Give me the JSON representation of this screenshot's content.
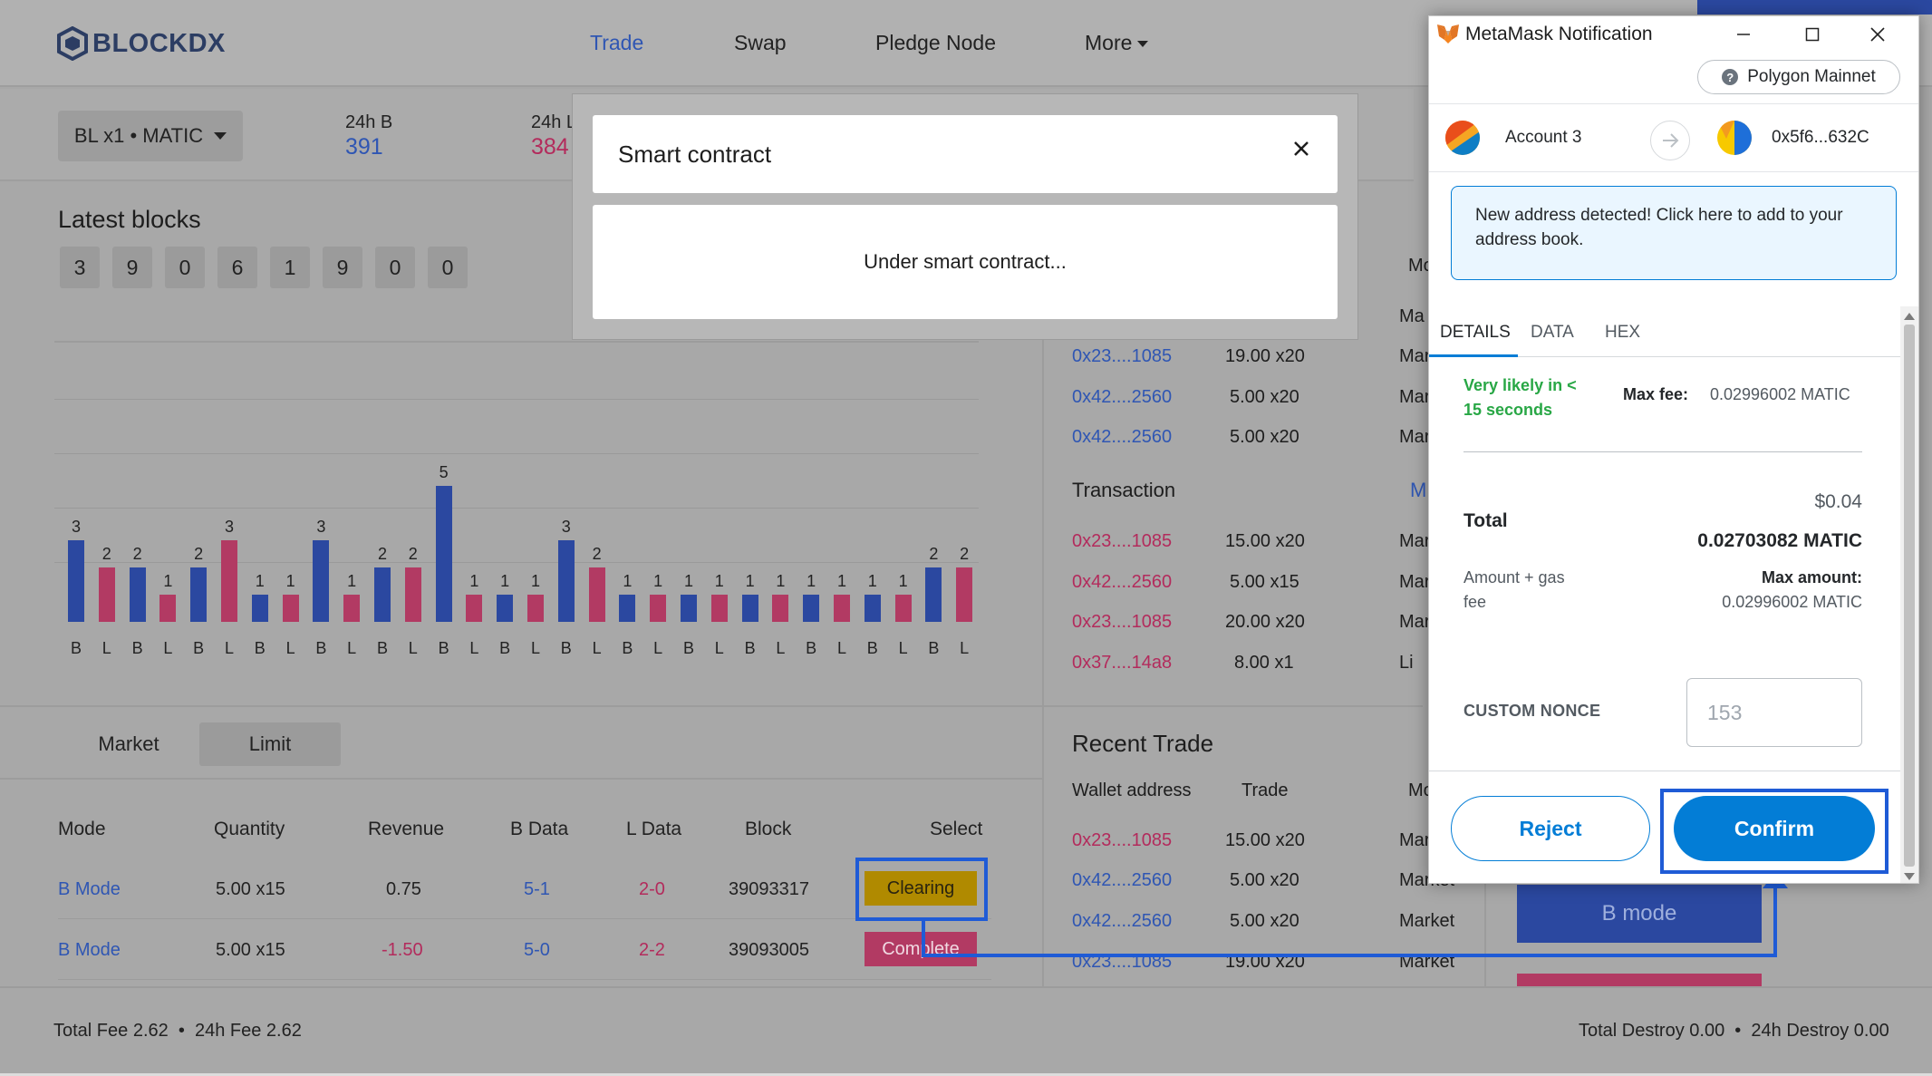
{
  "app": {
    "brand": "BLOCKDX",
    "nav": [
      "Trade",
      "Swap",
      "Pledge Node",
      "More"
    ],
    "active_nav": "Trade"
  },
  "market": {
    "pair": "BL x1 • MATIC",
    "stat1_label": "24h B",
    "stat1_value": "391",
    "stat2_label": "24h L",
    "stat2_value": "384"
  },
  "latest_blocks": {
    "title": "Latest blocks",
    "digits": [
      "3",
      "9",
      "0",
      "6",
      "1",
      "9",
      "0",
      "0"
    ]
  },
  "chart_data": {
    "type": "bar",
    "categories": [
      "B",
      "L",
      "B",
      "L",
      "B",
      "L",
      "B",
      "L",
      "B",
      "L",
      "B",
      "L",
      "B",
      "L",
      "B",
      "L",
      "B",
      "L",
      "B",
      "L",
      "B",
      "L",
      "B",
      "L",
      "B",
      "L",
      "B",
      "L",
      "B",
      "L"
    ],
    "values": [
      3,
      2,
      2,
      1,
      2,
      3,
      1,
      1,
      3,
      1,
      2,
      2,
      5,
      1,
      1,
      1,
      3,
      2,
      1,
      1,
      1,
      1,
      1,
      1,
      1,
      1,
      1,
      1,
      2,
      2
    ],
    "colors": {
      "B": "#2b48a0",
      "L": "#b23a63"
    },
    "ylim": [
      0,
      6
    ]
  },
  "order_tabs": [
    "Market",
    "Limit"
  ],
  "orders": {
    "headers": [
      "Mode",
      "Quantity",
      "Revenue",
      "B Data",
      "L Data",
      "Block",
      "Select"
    ],
    "rows": [
      {
        "mode": "B Mode",
        "qty": "5.00 x15",
        "revenue": "0.75",
        "bdata": "5-1",
        "ldata": "2-0",
        "block": "39093317",
        "status": "Clearing"
      },
      {
        "mode": "B Mode",
        "qty": "5.00 x15",
        "revenue": "-1.50",
        "bdata": "5-0",
        "ldata": "2-2",
        "block": "39093005",
        "status": "Complete"
      }
    ]
  },
  "footer": {
    "left": "Total Fee 2.62  •  24h Fee 2.62",
    "right": "Total Destroy 0.00  •  24h Destroy 0.00"
  },
  "side_panel": {
    "top_rows": [
      {
        "addr": "0x23....1085",
        "trade": "19.00 x20",
        "mode": "Mar"
      },
      {
        "addr": "0x42....2560",
        "trade": "5.00 x20",
        "mode": "Mar"
      },
      {
        "addr": "0x42....2560",
        "trade": "5.00 x20",
        "mode": "Mar"
      }
    ],
    "col_cut": "Mo",
    "col_cut2": "Ma",
    "transaction_title": "Transaction",
    "transaction_more": "M",
    "transactions": [
      {
        "addr": "0x23....1085",
        "trade": "15.00 x20",
        "mode": "Mar"
      },
      {
        "addr": "0x42....2560",
        "trade": "5.00 x15",
        "mode": "Mar"
      },
      {
        "addr": "0x23....1085",
        "trade": "20.00 x20",
        "mode": "Mar"
      },
      {
        "addr": "0x37....14a8",
        "trade": "8.00 x1",
        "mode": "Li"
      }
    ],
    "recent_title": "Recent Trade",
    "recent_headers": [
      "Wallet address",
      "Trade",
      "Mo"
    ],
    "recent_rows": [
      {
        "addr": "0x23....1085",
        "trade": "15.00 x20",
        "mode": "Mar"
      },
      {
        "addr": "0x42....2560",
        "trade": "5.00 x20",
        "mode": "Market"
      },
      {
        "addr": "0x42....2560",
        "trade": "5.00 x20",
        "mode": "Market"
      },
      {
        "addr": "0x23....1085",
        "trade": "19.00 x20",
        "mode": "Market"
      }
    ],
    "bmode_button": "B mode"
  },
  "modal": {
    "title": "Smart contract",
    "body": "Under smart contract..."
  },
  "metamask": {
    "window_title": "MetaMask Notification",
    "network": "Polygon Mainnet",
    "from_account": "Account 3",
    "to_address": "0x5f6...632C",
    "notice": "New address detected! Click here to add to your address book.",
    "tabs": [
      "DETAILS",
      "DATA",
      "HEX"
    ],
    "active_tab": "DETAILS",
    "fee_speed": "Very likely in < 15 seconds",
    "max_fee_label": "Max fee:",
    "max_fee_value": "0.02996002 MATIC",
    "total_label": "Total",
    "total_usd": "$0.04",
    "total_matic": "0.02703082 MATIC",
    "amount_gas_label": "Amount + gas fee",
    "max_amount_label": "Max amount:",
    "max_amount_value": "0.02996002 MATIC",
    "nonce_label": "CUSTOM NONCE",
    "nonce_placeholder": "153",
    "reject_label": "Reject",
    "confirm_label": "Confirm"
  }
}
